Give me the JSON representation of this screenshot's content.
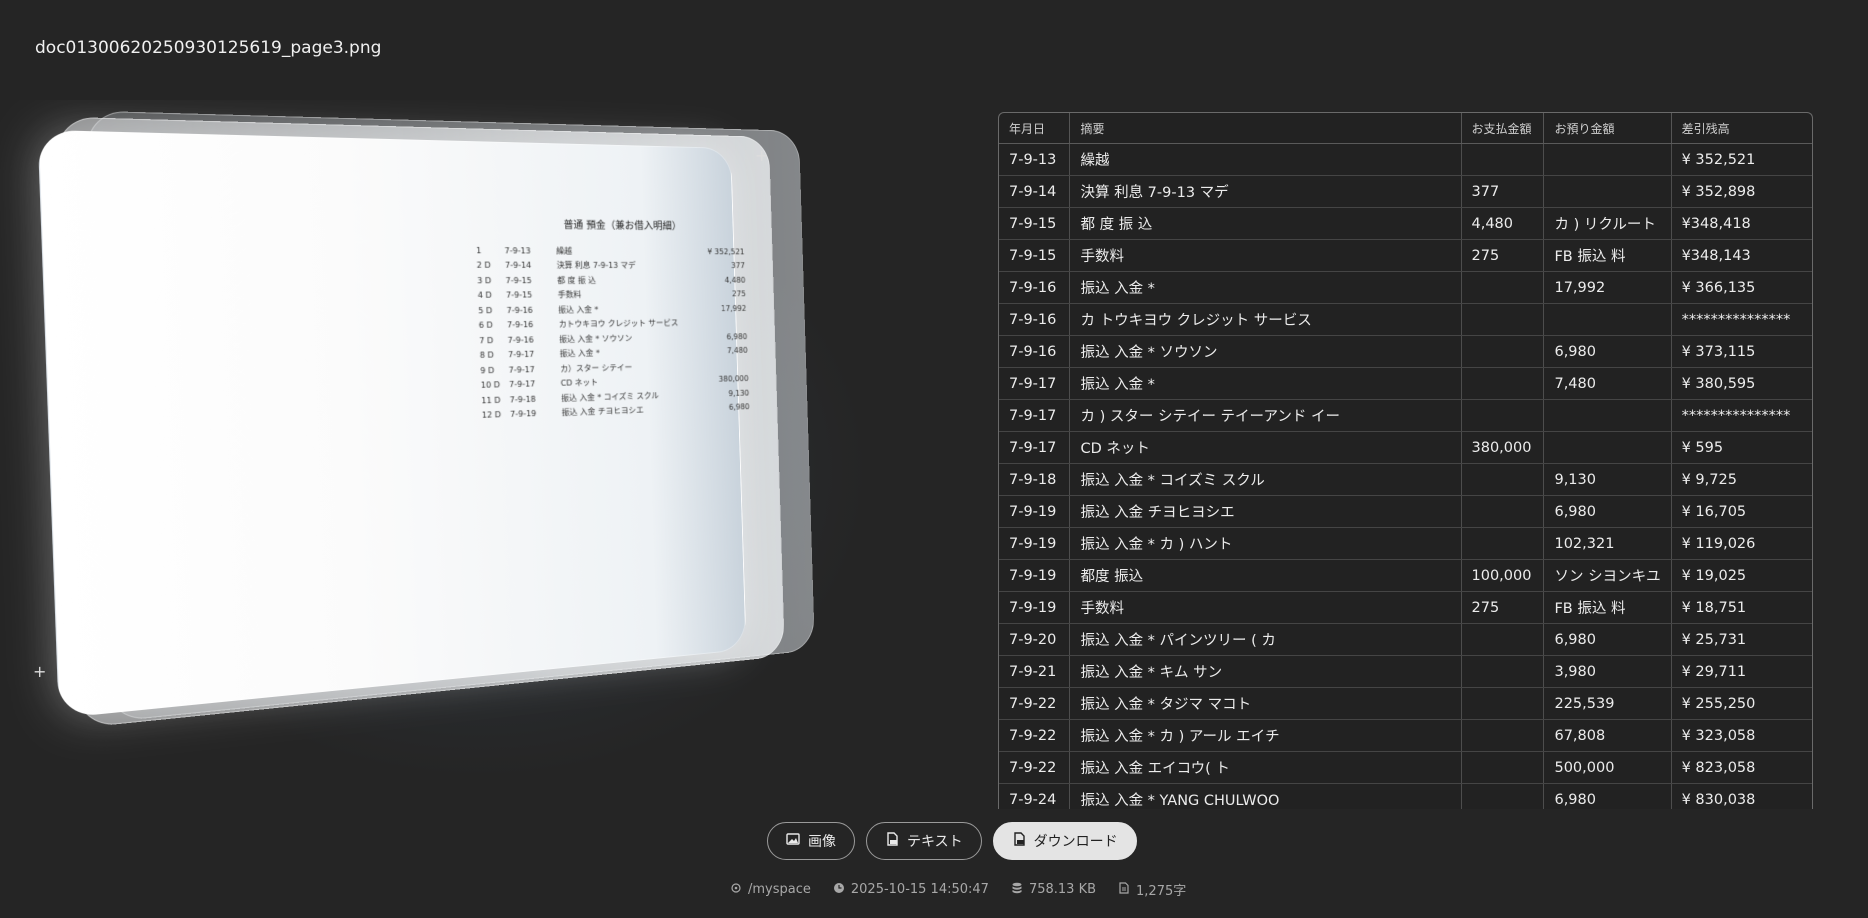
{
  "file": {
    "name": "doc01300620250930125619_page3.png"
  },
  "preview": {
    "title": "普通 預金（兼お借入明細）",
    "lines": [
      [
        "1",
        "7-9-13",
        "繰越",
        "¥ 352,521"
      ],
      [
        "2 D",
        "7-9-14",
        "決算 利息 7-9-13 マデ",
        "377"
      ],
      [
        "3 D",
        "7-9-15",
        "都 度 振 込",
        "4,480"
      ],
      [
        "4 D",
        "7-9-15",
        "手数料",
        "275"
      ],
      [
        "5 D",
        "7-9-16",
        "振込 入金 *",
        "17,992"
      ],
      [
        "6 D",
        "7-9-16",
        "カトウキヨウ クレジット サービス",
        ""
      ],
      [
        "7 D",
        "7-9-16",
        "振込 入金 * ソウソン",
        "6,980"
      ],
      [
        "8 D",
        "7-9-17",
        "振込 入金 *",
        "7,480"
      ],
      [
        "9 D",
        "7-9-17",
        "カ）スター シテイー",
        ""
      ],
      [
        "10 D",
        "7-9-17",
        "CD ネット",
        "380,000"
      ],
      [
        "11 D",
        "7-9-18",
        "振込 入金 * コイズミ スクル",
        "9,130"
      ],
      [
        "12 D",
        "7-9-19",
        "振込 入金 チヨヒヨシエ",
        "6,980"
      ]
    ]
  },
  "table": {
    "headers": [
      "年月日",
      "摘要",
      "お支払金額",
      "お預り金額",
      "差引残高"
    ],
    "rows": [
      [
        "7-9-13",
        "繰越",
        "",
        "",
        "¥ 352,521"
      ],
      [
        "7-9-14",
        "決算 利息 7-9-13 マデ",
        "377",
        "",
        "¥ 352,898"
      ],
      [
        "7-9-15",
        "都 度 振 込",
        "4,480",
        "カ ) リクルート",
        "¥348,418"
      ],
      [
        "7-9-15",
        "手数料",
        "275",
        "FB 振込 料",
        "¥348,143"
      ],
      [
        "7-9-16",
        "振込 入金 *",
        "",
        "17,992",
        "¥ 366,135"
      ],
      [
        "7-9-16",
        "カ トウキヨウ クレジット サービス",
        "",
        "",
        "***************"
      ],
      [
        "7-9-16",
        "振込 入金 * ソウソン",
        "",
        "6,980",
        "¥ 373,115"
      ],
      [
        "7-9-17",
        "振込 入金 *",
        "",
        "7,480",
        "¥ 380,595"
      ],
      [
        "7-9-17",
        "カ ) スター シテイー テイーアンド イー",
        "",
        "",
        "***************"
      ],
      [
        "7-9-17",
        "CD ネット",
        "380,000",
        "",
        "¥ 595"
      ],
      [
        "7-9-18",
        "振込 入金 * コイズミ スクル",
        "",
        "9,130",
        "¥ 9,725"
      ],
      [
        "7-9-19",
        "振込 入金 チヨヒヨシエ",
        "",
        "6,980",
        "¥ 16,705"
      ],
      [
        "7-9-19",
        "振込 入金 * カ ) ハント",
        "",
        "102,321",
        "¥ 119,026"
      ],
      [
        "7-9-19",
        "都度 振込",
        "100,000",
        "ソン シヨンキユ",
        "¥ 19,025"
      ],
      [
        "7-9-19",
        "手数料",
        "275",
        "FB 振込 料",
        "¥ 18,751"
      ],
      [
        "7-9-20",
        "振込 入金 * パインツリー ( カ",
        "",
        "6,980",
        "¥ 25,731"
      ],
      [
        "7-9-21",
        "振込 入金 * キム サン",
        "",
        "3,980",
        "¥ 29,711"
      ],
      [
        "7-9-22",
        "振込 入金 * タジマ マコト",
        "",
        "225,539",
        "¥ 255,250"
      ],
      [
        "7-9-22",
        "振込 入金 * カ ) アール エイチ",
        "",
        "67,808",
        "¥ 323,058"
      ],
      [
        "7-9-22",
        "振込 入金 エイコウ( ト",
        "",
        "500,000",
        "¥ 823,058"
      ],
      [
        "7-9-24",
        "振込 入金 * YANG CHULWOO",
        "",
        "6,980",
        "¥ 830,038"
      ]
    ]
  },
  "actions": {
    "image_label": "画像",
    "text_label": "テキスト",
    "download_label": "ダウンロード"
  },
  "meta": {
    "path": "/myspace",
    "datetime": "2025-10-15 14:50:47",
    "size": "758.13 KB",
    "chars": "1,275字"
  },
  "icons": {
    "image": "image-icon",
    "text": "text-file-icon",
    "download": "download-file-icon",
    "path": "location-icon",
    "time": "clock-icon",
    "size": "database-icon",
    "chars": "document-icon"
  }
}
